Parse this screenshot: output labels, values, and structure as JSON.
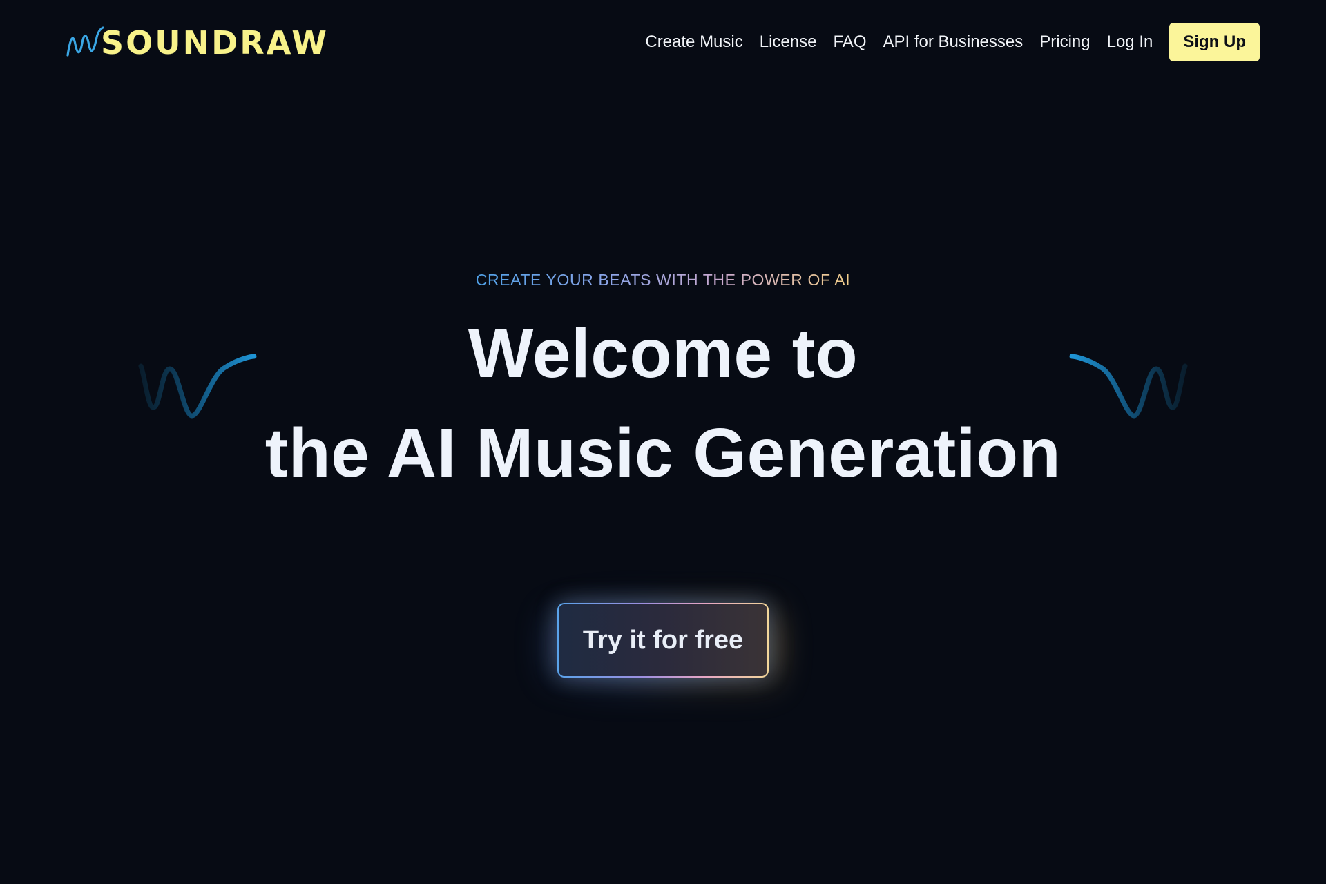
{
  "brand": {
    "name": "SOUNDRAW",
    "logo_icon": "waveform-icon",
    "color_text": "#f8f28a",
    "color_wave": "#3aa6e4"
  },
  "nav": {
    "items": [
      {
        "label": "Create Music"
      },
      {
        "label": "License"
      },
      {
        "label": "FAQ"
      },
      {
        "label": "API for Businesses"
      },
      {
        "label": "Pricing"
      },
      {
        "label": "Log In"
      }
    ],
    "signup_label": "Sign Up",
    "signup_bg": "#fbf59a",
    "signup_text_color": "#0c0f16"
  },
  "hero": {
    "tagline": "CREATE YOUR BEATS WITH THE POWER OF AI",
    "headline_line1": "Welcome to",
    "headline_line2": "the AI Music Generation",
    "cta_label": "Try it for free",
    "decor_icon": "sound-wave-icon"
  },
  "colors": {
    "background": "#070b14",
    "headline": "#eef3fb",
    "wave_blue": "#1f8fd0"
  }
}
